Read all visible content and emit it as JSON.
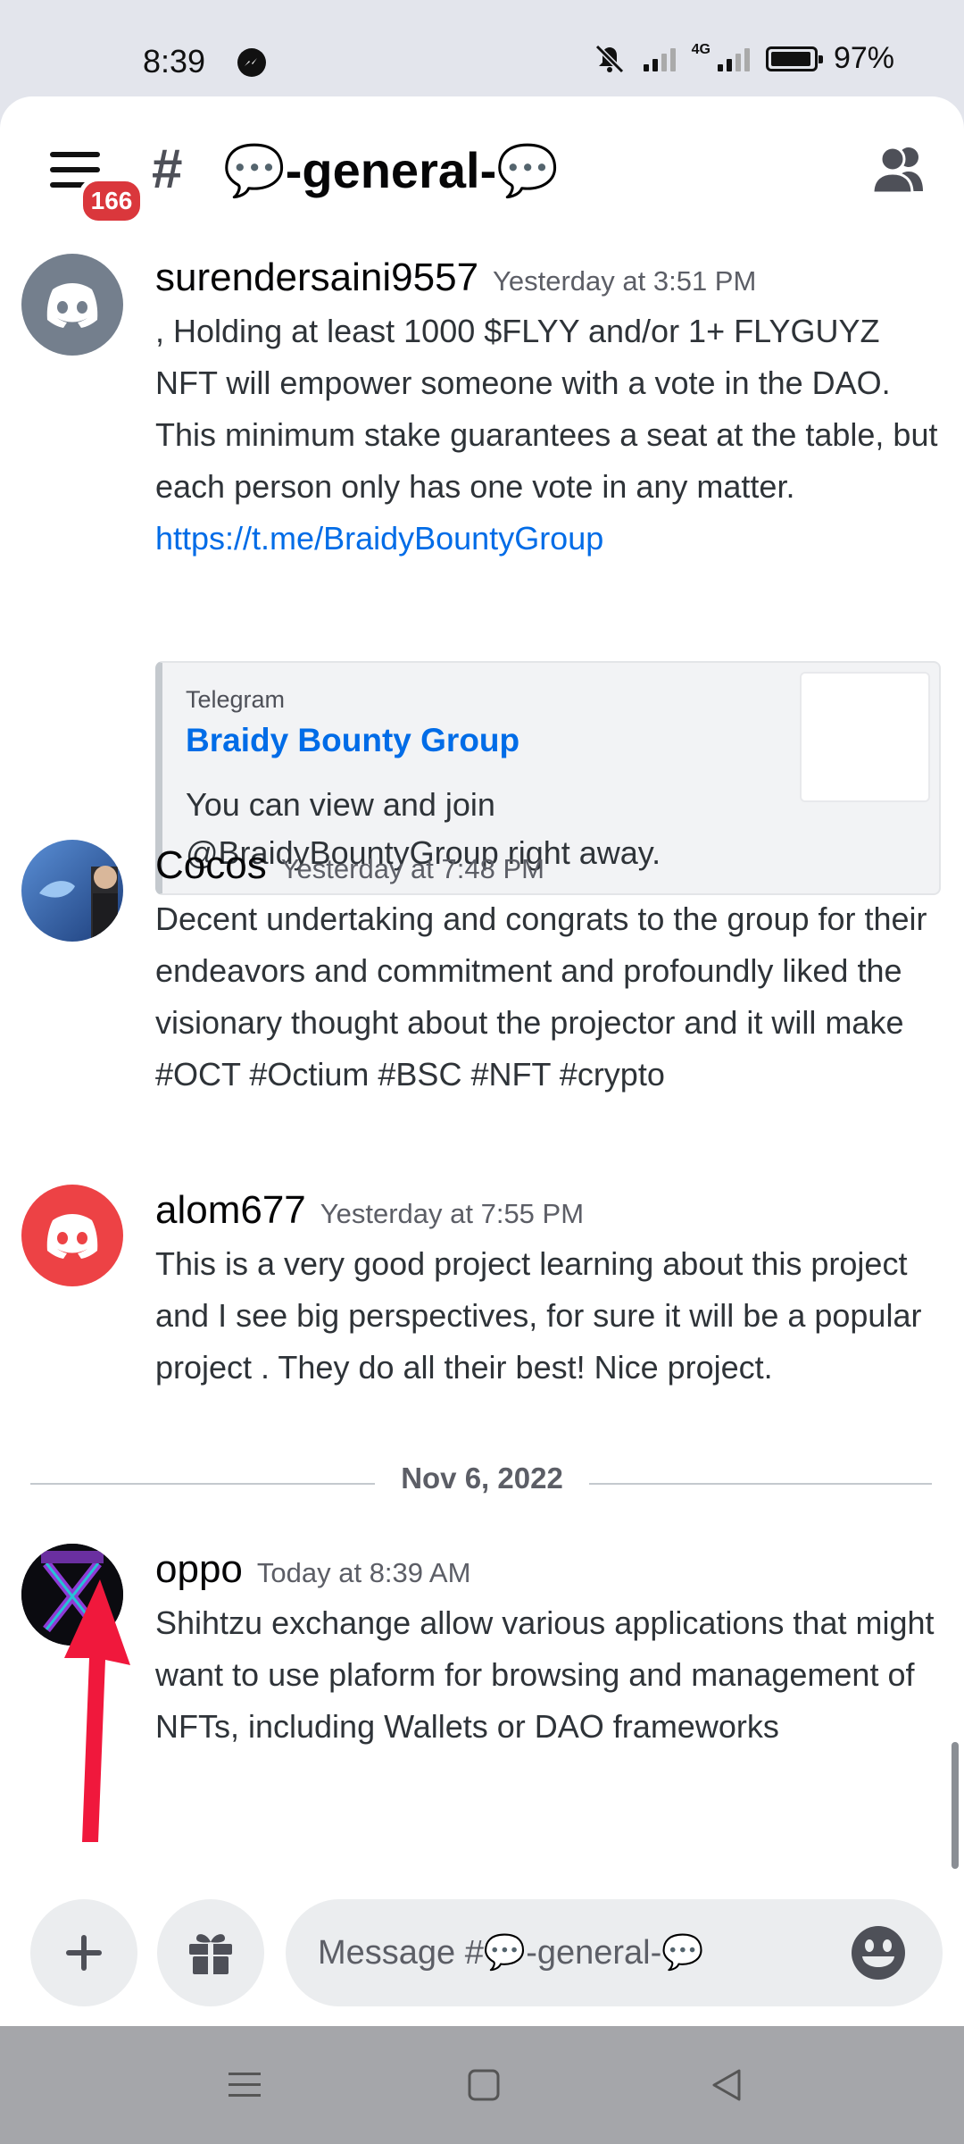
{
  "status_bar": {
    "time": "8:39",
    "network": "4G",
    "battery": "97%"
  },
  "header": {
    "unread_badge": "166",
    "channel_name": "💬-general-💬"
  },
  "messages": [
    {
      "username": "surendersaini9557",
      "timestamp": "Yesterday at 3:51 PM",
      "text": ", Holding at least 1000 $FLYY and/or 1+ FLYGUYZ NFT will empower someone with a vote in the DAO. This minimum stake guarantees a seat at the table, but each person only has one vote in any matter. ",
      "link": "https://t.me/BraidyBountyGroup",
      "embed": {
        "provider": "Telegram",
        "title": "Braidy Bounty Group",
        "description": "You can view and join @BraidyBountyGroup right away."
      }
    },
    {
      "username": "Cocos",
      "timestamp": "Yesterday at 7:48 PM",
      "text": "Decent undertaking and congrats to the group for their endeavors and commitment and profoundly liked the visionary thought about the projector and it will make",
      "text2": "#OCT #Octium #BSC #NFT #crypto"
    },
    {
      "username": "alom677",
      "timestamp": "Yesterday at 7:55 PM",
      "text": "This is a very good project learning about this project and I see big perspectives, for sure it will be a popular project . They do all their best! Nice project."
    },
    {
      "username": "oppo",
      "timestamp": "Today at 8:39 AM",
      "text": "Shihtzu exchange allow various applications that might want to use  plaform for browsing and management of NFTs, including Wallets or DAO frameworks"
    }
  ],
  "date_divider": "Nov 6, 2022",
  "composer": {
    "placeholder": "Message #💬-general-💬"
  },
  "colors": {
    "accent_link": "#006ce7",
    "badge_red": "#da373c",
    "discord_grey_avatar": "#747f8d",
    "discord_red_avatar": "#ed4245",
    "arrow_red": "#f0183c"
  },
  "icons": [
    "hamburger-menu-icon",
    "hash-icon",
    "members-icon",
    "discord-logo-icon",
    "plus-icon",
    "gift-icon",
    "emoji-icon"
  ]
}
